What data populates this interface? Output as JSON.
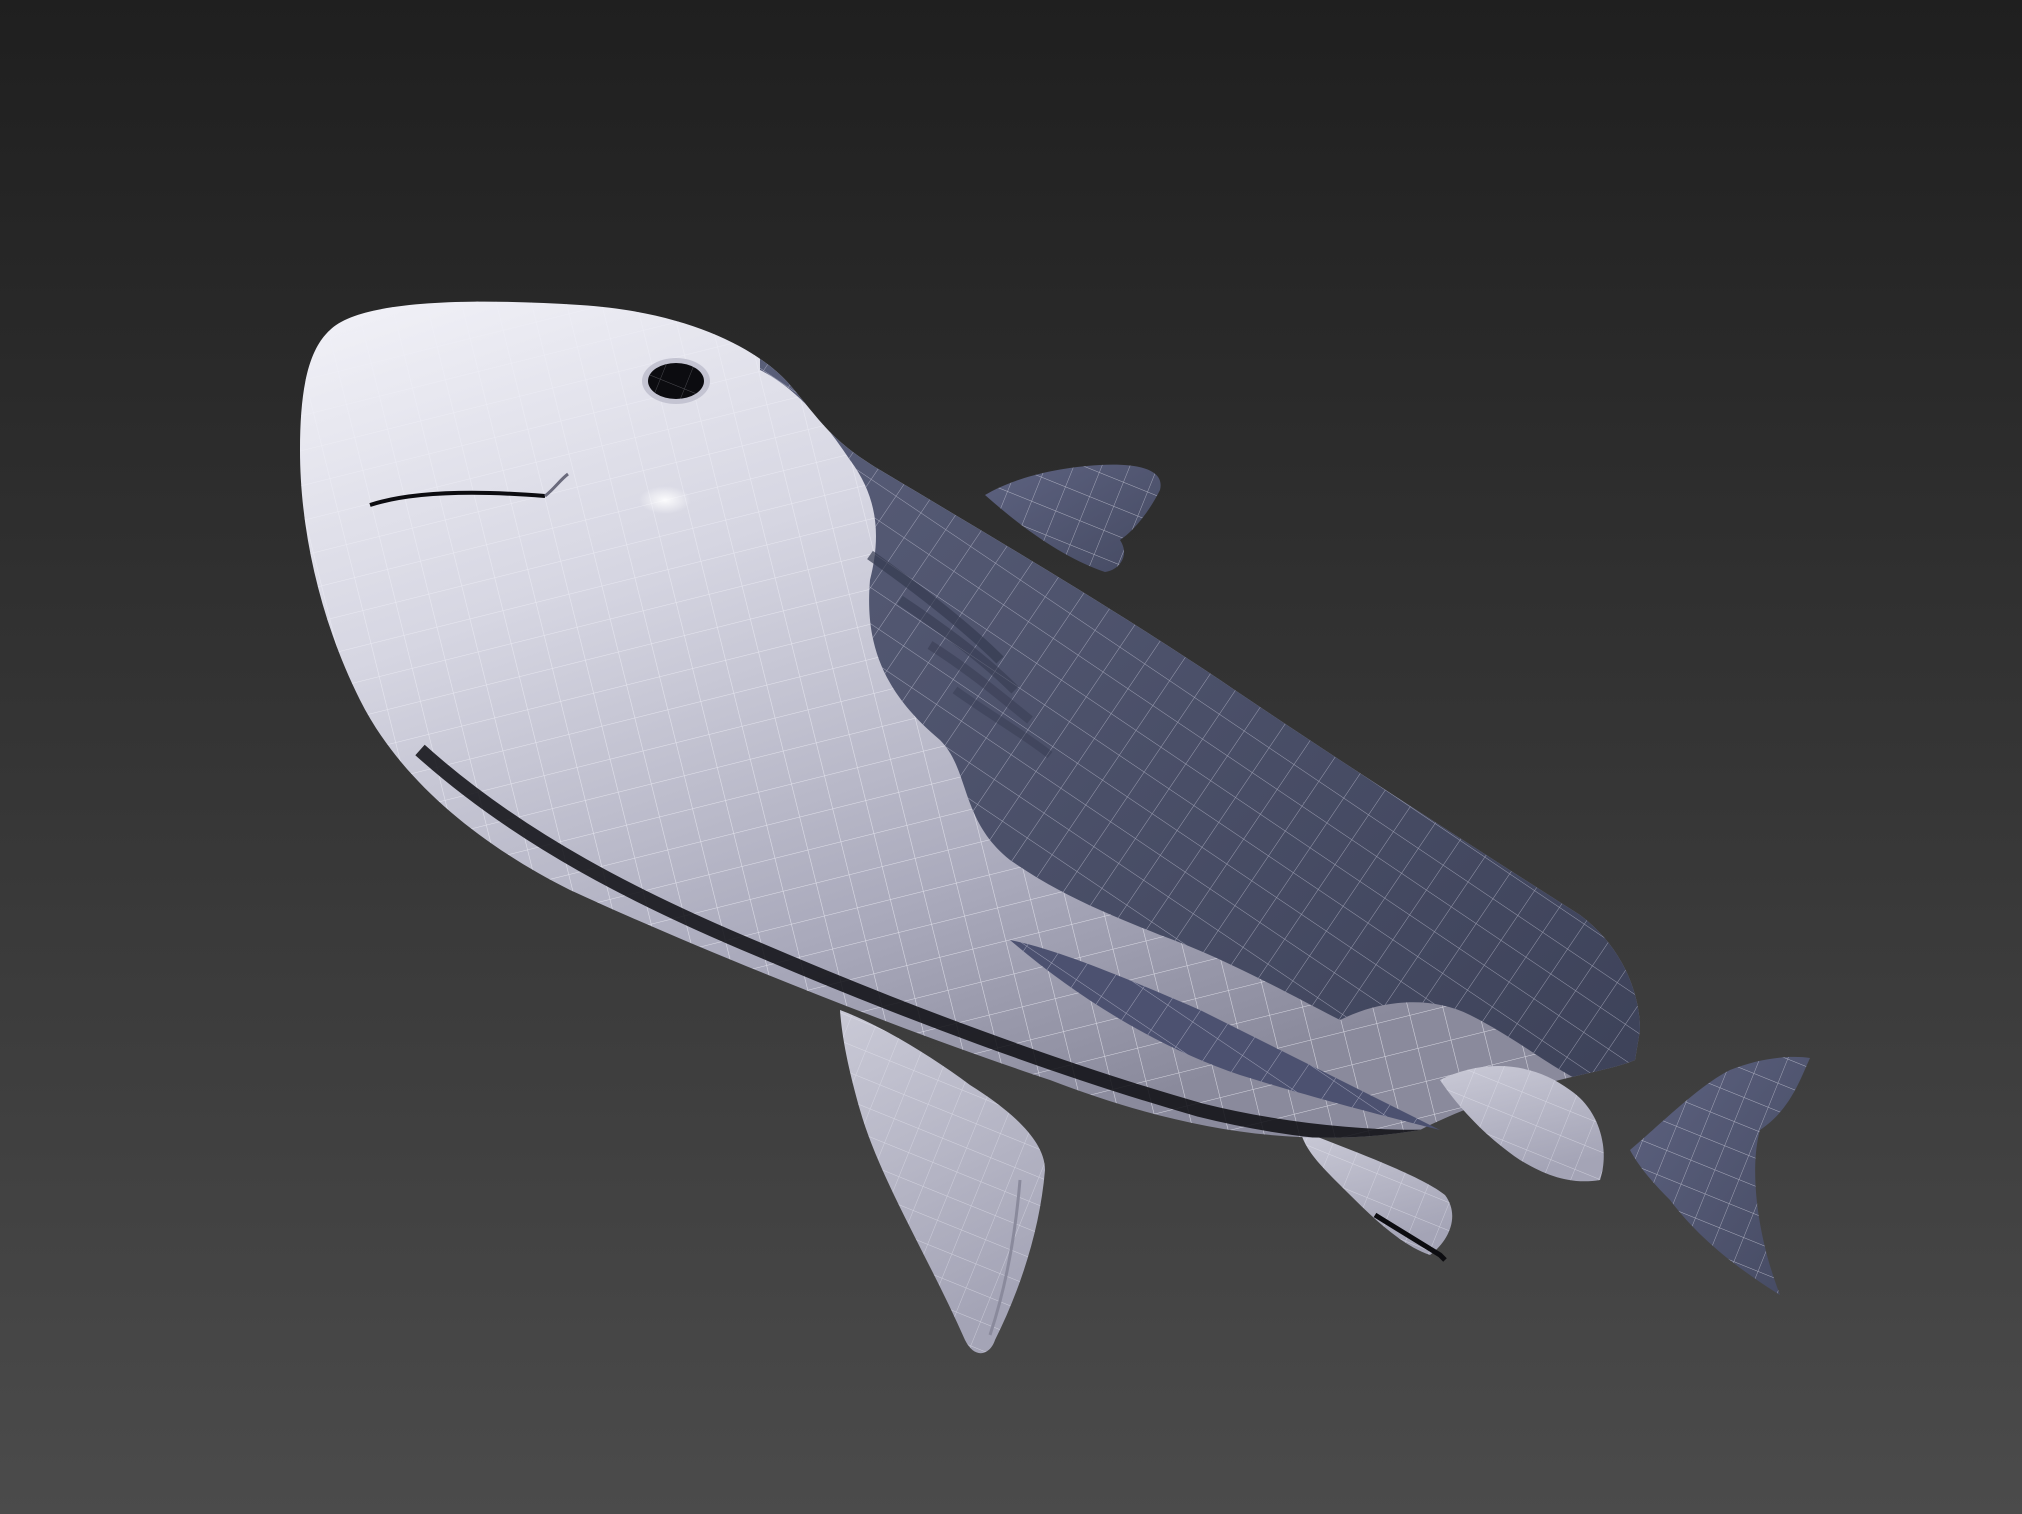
{
  "viewport": {
    "background_top": "#1f1f1f",
    "background_bottom": "#4b4b4b",
    "wire_color": "#e8e8f2"
  },
  "model": {
    "name": "shark",
    "belly_color": "#b8b8c8",
    "back_color": "#4b5068",
    "eye_color": "#0c0c10"
  }
}
